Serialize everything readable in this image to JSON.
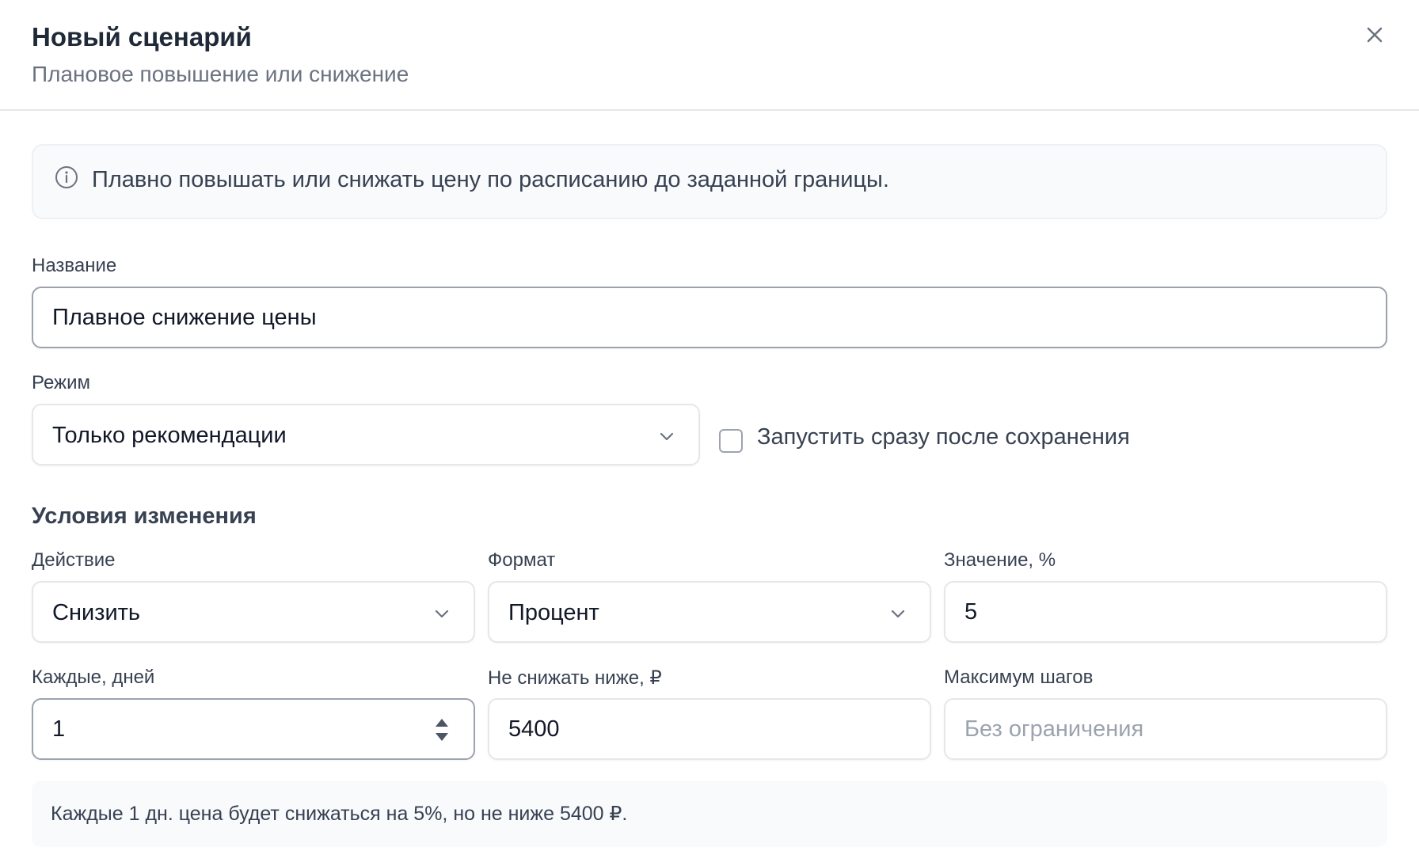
{
  "dialog": {
    "title": "Новый сценарий",
    "subtitle": "Плановое повышение или снижение"
  },
  "info": {
    "text": "Плавно повышать или снижать цену по расписанию до заданной границы."
  },
  "form": {
    "name_label": "Название",
    "name_value": "Плавное снижение цены",
    "mode_label": "Режим",
    "mode_value": "Только рекомендации",
    "autostart_label": "Запустить сразу после сохранения",
    "autostart_checked": false
  },
  "conditions": {
    "title": "Условия изменения",
    "action_label": "Действие",
    "action_value": "Снизить",
    "format_label": "Формат",
    "format_value": "Процент",
    "value_label": "Значение, %",
    "value_value": "5",
    "every_label": "Каждые, дней",
    "every_value": "1",
    "floor_label": "Не снижать ниже, ₽",
    "floor_value": "5400",
    "max_steps_label": "Максимум шагов",
    "max_steps_placeholder": "Без ограничения"
  },
  "summary": {
    "text": "Каждые 1 дн. цена будет снижаться на 5%, но не ниже 5400 ₽."
  },
  "icons": {
    "close": "close-icon",
    "info": "info-icon",
    "chevron": "chevron-down-icon",
    "spinner": "spinner-arrows-icon"
  },
  "colors": {
    "text_primary": "#1f2937",
    "text_secondary": "#6b7280",
    "border": "#e5e7eb",
    "surface_muted": "#f8fafc"
  }
}
